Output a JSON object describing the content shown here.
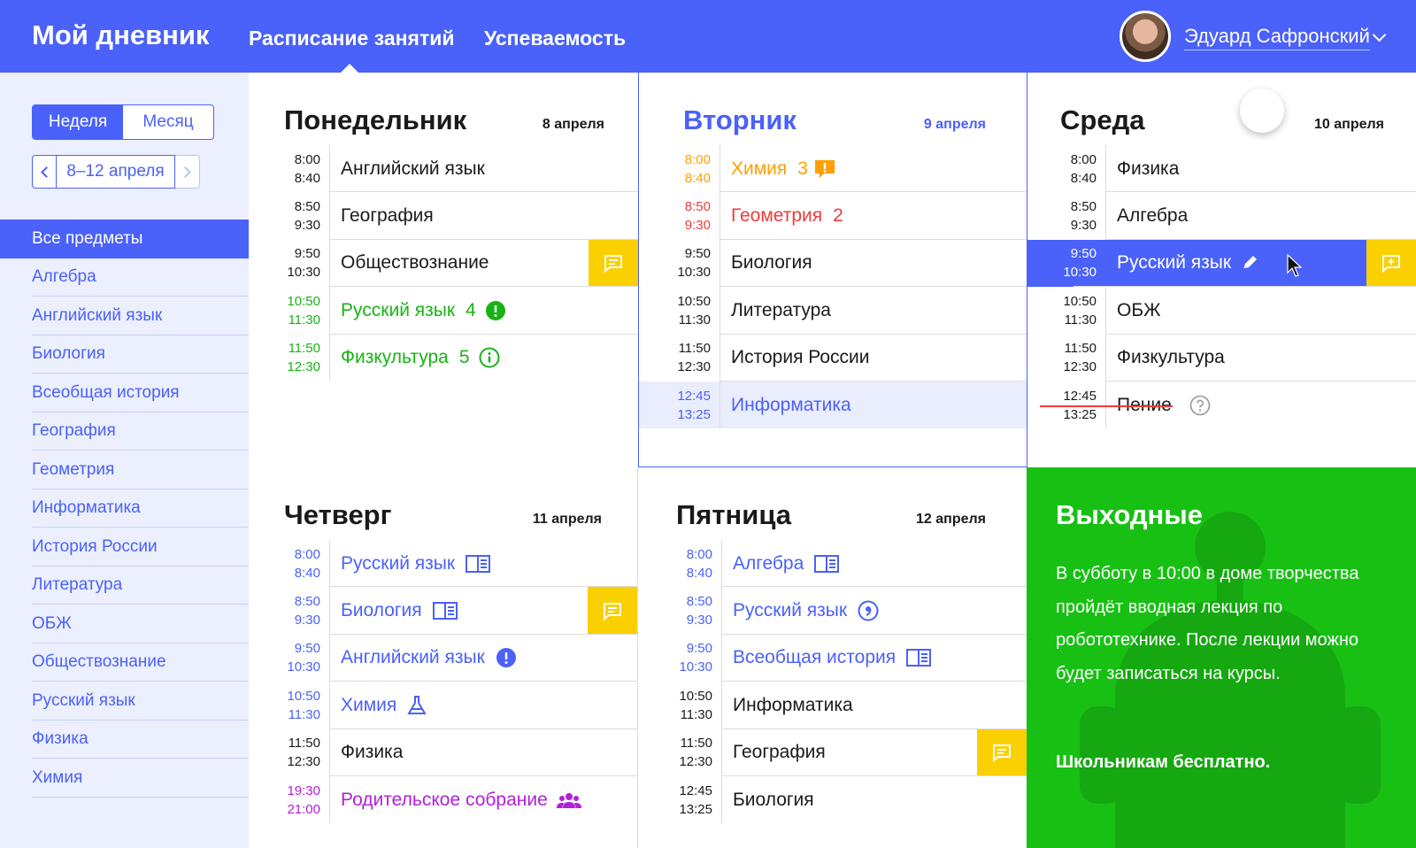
{
  "header": {
    "logo": "Мой дневник",
    "nav_schedule": "Расписание занятий",
    "nav_grades": "Успеваемость",
    "user_name": "Эдуард Сафронский"
  },
  "sidebar": {
    "view_week": "Неделя",
    "view_month": "Месяц",
    "week_range": "8–12 апреля",
    "subjects": [
      "Все предметы",
      "Алгебра",
      "Английский язык",
      "Биология",
      "Всеобщая история",
      "География",
      "Геометрия",
      "Информатика",
      "История России",
      "Литература",
      "ОБЖ",
      "Обществознание",
      "Русский язык",
      "Физика",
      "Химия"
    ]
  },
  "days": {
    "mon": {
      "title": "Понедельник",
      "date": "8 апреля",
      "lessons": [
        {
          "start": "8:00",
          "end": "8:40",
          "subject": "Английский язык"
        },
        {
          "start": "8:50",
          "end": "9:30",
          "subject": "География"
        },
        {
          "start": "9:50",
          "end": "10:30",
          "subject": "Обществознание"
        },
        {
          "start": "10:50",
          "end": "11:30",
          "subject": "Русский язык",
          "grade": "4"
        },
        {
          "start": "11:50",
          "end": "12:30",
          "subject": "Физкультура",
          "grade": "5"
        }
      ]
    },
    "tue": {
      "title": "Вторник",
      "date": "9 апреля",
      "lessons": [
        {
          "start": "8:00",
          "end": "8:40",
          "subject": "Химия",
          "grade": "3"
        },
        {
          "start": "8:50",
          "end": "9:30",
          "subject": "Геометрия",
          "grade": "2"
        },
        {
          "start": "9:50",
          "end": "10:30",
          "subject": "Биология"
        },
        {
          "start": "10:50",
          "end": "11:30",
          "subject": "Литература"
        },
        {
          "start": "11:50",
          "end": "12:30",
          "subject": "История России"
        },
        {
          "start": "12:45",
          "end": "13:25",
          "subject": "Информатика"
        }
      ]
    },
    "wed": {
      "title": "Среда",
      "date": "10 апреля",
      "lessons": [
        {
          "start": "8:00",
          "end": "8:40",
          "subject": "Физика"
        },
        {
          "start": "8:50",
          "end": "9:30",
          "subject": "Алгебра"
        },
        {
          "start": "9:50",
          "end": "10:30",
          "subject": "Русский язык"
        },
        {
          "start": "10:50",
          "end": "11:30",
          "subject": "ОБЖ"
        },
        {
          "start": "11:50",
          "end": "12:30",
          "subject": "Физкультура"
        },
        {
          "start": "12:45",
          "end": "13:25",
          "subject": "Пение"
        }
      ]
    },
    "thu": {
      "title": "Четверг",
      "date": "11 апреля",
      "lessons": [
        {
          "start": "8:00",
          "end": "8:40",
          "subject": "Русский язык"
        },
        {
          "start": "8:50",
          "end": "9:30",
          "subject": "Биология"
        },
        {
          "start": "9:50",
          "end": "10:30",
          "subject": "Английский язык"
        },
        {
          "start": "10:50",
          "end": "11:30",
          "subject": "Химия"
        },
        {
          "start": "11:50",
          "end": "12:30",
          "subject": "Физика"
        },
        {
          "start": "19:30",
          "end": "21:00",
          "subject": "Родительское собрание"
        }
      ]
    },
    "fri": {
      "title": "Пятница",
      "date": "12 апреля",
      "lessons": [
        {
          "start": "8:00",
          "end": "8:40",
          "subject": "Алгебра"
        },
        {
          "start": "8:50",
          "end": "9:30",
          "subject": "Русский язык"
        },
        {
          "start": "9:50",
          "end": "10:30",
          "subject": "Всеобщая история"
        },
        {
          "start": "10:50",
          "end": "11:30",
          "subject": "Информатика"
        },
        {
          "start": "11:50",
          "end": "12:30",
          "subject": "География"
        },
        {
          "start": "12:45",
          "end": "13:25",
          "subject": "Биология"
        }
      ]
    }
  },
  "weekend": {
    "title": "Выходные",
    "text": "В субботу в 10:00 в доме творчества пройдёт вводная лекция по робототехнике. После лекции можно будет записаться на курсы.",
    "bold": "Школьникам бесплатно."
  },
  "colors": {
    "accent": "#4a61fa",
    "success": "#18b314",
    "warning": "#ff9f00",
    "danger": "#f03a3a",
    "note": "#fbd000",
    "event": "#b21fd9",
    "weekend_bg": "#18c014"
  }
}
